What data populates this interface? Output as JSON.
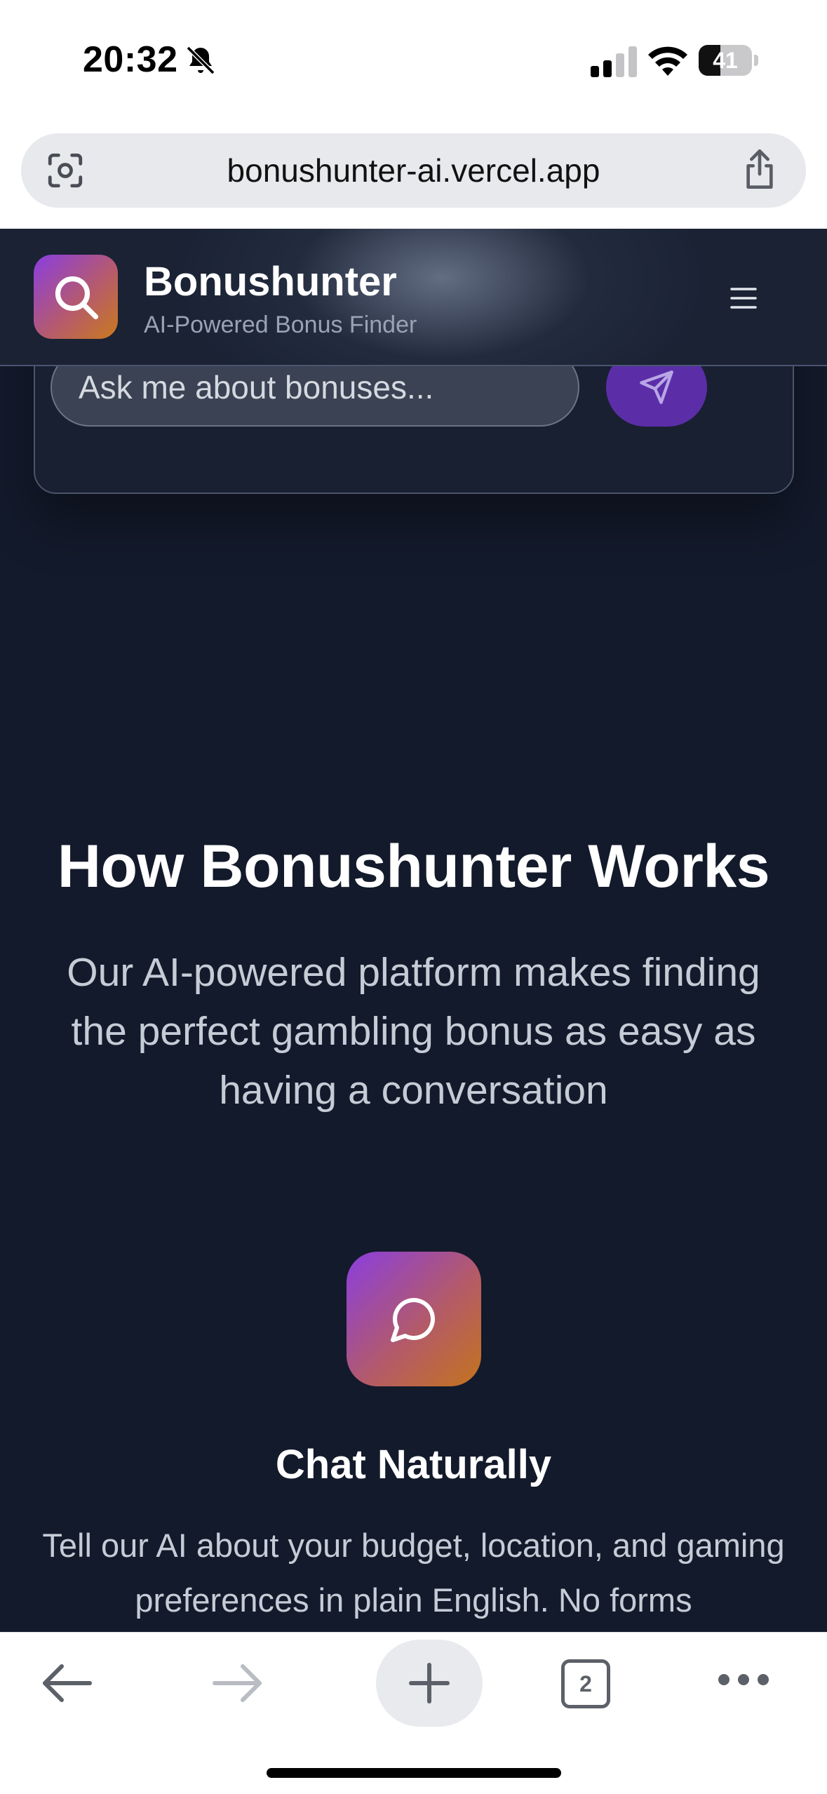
{
  "status_bar": {
    "time": "20:32",
    "battery_level": "41",
    "icons": [
      "bell-slash-icon",
      "cellular-signal-icon",
      "wifi-icon",
      "battery-icon"
    ]
  },
  "browser": {
    "url": "bonushunter-ai.vercel.app",
    "icons": [
      "lens-icon",
      "share-icon"
    ]
  },
  "header": {
    "brand": "Bonushunter",
    "tagline": "AI-Powered Bonus Finder",
    "icons": [
      "search-icon",
      "menu-icon"
    ]
  },
  "chat": {
    "placeholder": "Ask me about bonuses...",
    "send_icon": "send-icon"
  },
  "section": {
    "title": "How Bonushunter Works",
    "subtitle": "Our AI-powered platform makes finding the perfect gambling bonus as easy as having a conversation"
  },
  "feature": {
    "icon": "chat-bubble-icon",
    "title": "Chat Naturally",
    "description": "Tell our AI about your budget, location, and gaming preferences in plain English. No forms"
  },
  "toolbar": {
    "tab_count": "2",
    "icons": [
      "back-arrow-icon",
      "forward-arrow-icon",
      "plus-icon",
      "tabs-icon",
      "more-icon"
    ]
  },
  "colors": {
    "page_background": "#131a2b",
    "accent_purple": "#8a3ee0",
    "accent_orange": "#c97a1d",
    "send_button": "#5b2ea8"
  }
}
